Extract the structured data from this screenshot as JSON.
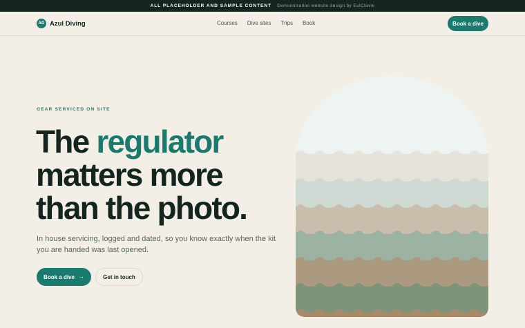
{
  "announcement": {
    "strong": "ALL PLACEHOLDER AND SAMPLE CONTENT",
    "muted": "Demonstration website design by EulClavie"
  },
  "brand": {
    "initials": "AD",
    "name": "Azul Diving"
  },
  "nav": {
    "items": [
      {
        "label": "Courses"
      },
      {
        "label": "Dive sites"
      },
      {
        "label": "Trips"
      },
      {
        "label": "Book"
      }
    ],
    "cta": "Book a dive"
  },
  "hero": {
    "eyebrow": "GEAR SERVICED ON SITE",
    "headline": {
      "line1_plain": "The",
      "line1_accent": "regulator",
      "line2": "matters more",
      "line3": "than the photo."
    },
    "lead": "In house servicing, logged and dated, so you know exactly when the kit you are handed was last opened.",
    "primary_button": "Book a dive",
    "primary_icon": "arrow-right-icon",
    "secondary_button": "Get in touch"
  },
  "colors": {
    "accent": "#1a7a6e",
    "background": "#f3efe7",
    "dark": "#14241f",
    "wave_bands": [
      "#eef4f2",
      "#e8e3da",
      "#cdd9d2",
      "#c9bdab",
      "#9cb2a2",
      "#ab9a80",
      "#7e9478",
      "#a8896a"
    ]
  }
}
